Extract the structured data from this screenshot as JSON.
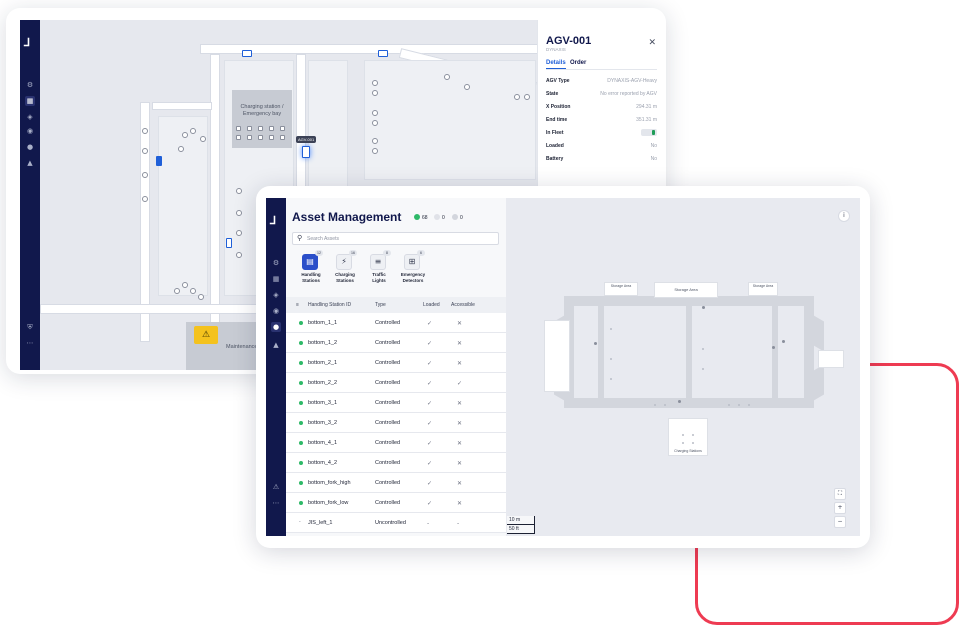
{
  "back_window": {
    "map": {
      "charging_bay_label": "Charging station /\nEmergency bay",
      "agv_tag": "AGV-001",
      "maintenance_label": "Maintenance a"
    },
    "sidebar": {
      "logo": "⅃",
      "icons": [
        "sidebar-gear",
        "sidebar-map",
        "sidebar-layers",
        "sidebar-eye",
        "sidebar-assets",
        "sidebar-bell",
        "sidebar-shield",
        "sidebar-more"
      ]
    },
    "detail_panel": {
      "title": "AGV-001",
      "subtitle": "DYNAXIS",
      "close": "✕",
      "tabs": [
        {
          "label": "Details",
          "active": true
        },
        {
          "label": "Order",
          "active": false
        }
      ],
      "rows": [
        {
          "key": "AGV Type",
          "value": "DYNAXIS-AGV-Heavy"
        },
        {
          "key": "State",
          "value": "No error reported by AGV"
        },
        {
          "key": "X Position",
          "value": "294.31 m"
        },
        {
          "key": "End time",
          "value": "351.31 m"
        },
        {
          "key": "In Fleet",
          "value": ""
        },
        {
          "key": "Loaded",
          "value": "No"
        },
        {
          "key": "Battery",
          "value": "No"
        }
      ],
      "in_fleet_toggle": true
    }
  },
  "front_window": {
    "sidebar": {
      "logo": "⅃",
      "icons": [
        "⚙",
        "▦",
        "◈",
        "◉",
        "●",
        "▲",
        "⚠",
        "⋯"
      ]
    },
    "title": "Asset Management",
    "stats": {
      "green": "68",
      "warning": "0",
      "grey": "0"
    },
    "search": {
      "placeholder": "Search Assets",
      "value": ""
    },
    "categories": [
      {
        "label": "Handling\nStations",
        "count": "12",
        "icon": "▤",
        "active": true
      },
      {
        "label": "Charging\nStations",
        "count": "16",
        "icon": "⚡",
        "active": false
      },
      {
        "label": "Traffic\nLights",
        "count": "8",
        "icon": "≡",
        "active": false
      },
      {
        "label": "Emergency\nDetectors",
        "count": "6",
        "icon": "⊞",
        "active": false
      }
    ],
    "table": {
      "headers": [
        "Handling Station ID",
        "Type",
        "Loaded",
        "Accessible"
      ],
      "rows": [
        {
          "id": "bottom_1_1",
          "type": "Controlled",
          "loaded": "✓",
          "accessible": "✕",
          "status": "green"
        },
        {
          "id": "bottom_1_2",
          "type": "Controlled",
          "loaded": "✓",
          "accessible": "✕",
          "status": "green"
        },
        {
          "id": "bottom_2_1",
          "type": "Controlled",
          "loaded": "✓",
          "accessible": "✕",
          "status": "green"
        },
        {
          "id": "bottom_2_2",
          "type": "Controlled",
          "loaded": "✓",
          "accessible": "✓",
          "status": "green"
        },
        {
          "id": "bottom_3_1",
          "type": "Controlled",
          "loaded": "✓",
          "accessible": "✕",
          "status": "green"
        },
        {
          "id": "bottom_3_2",
          "type": "Controlled",
          "loaded": "✓",
          "accessible": "✕",
          "status": "green"
        },
        {
          "id": "bottom_4_1",
          "type": "Controlled",
          "loaded": "✓",
          "accessible": "✕",
          "status": "green"
        },
        {
          "id": "bottom_4_2",
          "type": "Controlled",
          "loaded": "✓",
          "accessible": "✕",
          "status": "green"
        },
        {
          "id": "bottom_fork_high",
          "type": "Controlled",
          "loaded": "✓",
          "accessible": "✕",
          "status": "green"
        },
        {
          "id": "bottom_fork_low",
          "type": "Controlled",
          "loaded": "✓",
          "accessible": "✕",
          "status": "green"
        },
        {
          "id": "JIS_left_1",
          "type": "Uncontrolled",
          "loaded": "-",
          "accessible": "-",
          "status": "none"
        }
      ]
    },
    "map": {
      "labels": {
        "left_small": "Storage Area",
        "storage": "Storage Area",
        "right_small": "Storage Area",
        "charging": "Charging Stations"
      },
      "scale": [
        "10 m",
        "50 ft"
      ],
      "buttons": {
        "info": "i",
        "fit": "⛶",
        "zoom_in": "+",
        "zoom_out": "−"
      }
    }
  },
  "colors": {
    "brand_navy": "#11184c",
    "accent_blue": "#2b4fc9",
    "status_green": "#2fb968",
    "warning_yellow": "#f4c21d",
    "frame_red": "#ee3b52"
  }
}
